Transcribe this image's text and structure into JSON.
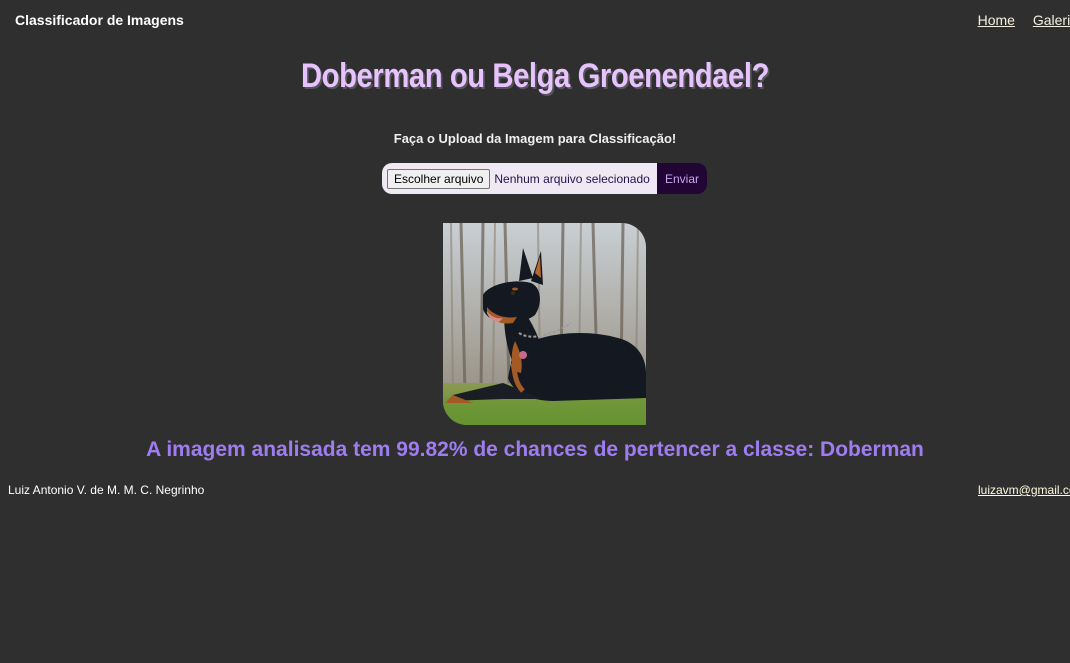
{
  "header": {
    "brand": "Classificador de Imagens",
    "nav": [
      {
        "label": "Home"
      },
      {
        "label": "Galeria"
      }
    ]
  },
  "main": {
    "title": "Doberman ou Belga Groenendael?",
    "subtitle": "Faça o Upload da Imagem para Classificação!",
    "upload": {
      "choose_label": "Escolher arquivo",
      "file_status": "Nenhum arquivo selecionado",
      "submit_label": "Enviar"
    },
    "image": {
      "subject": "doberman-photo"
    },
    "result_text": "A imagem analisada tem 99.82% de chances de pertencer a classe: Doberman"
  },
  "footer": {
    "author": "Luiz Antonio V. de M. M. C. Negrinho",
    "email": "luizavm@gmail.com"
  },
  "colors": {
    "background": "#2f2f2f",
    "title": "#e6c3ff",
    "result": "#9f7df0",
    "submit_bg": "#200535"
  }
}
